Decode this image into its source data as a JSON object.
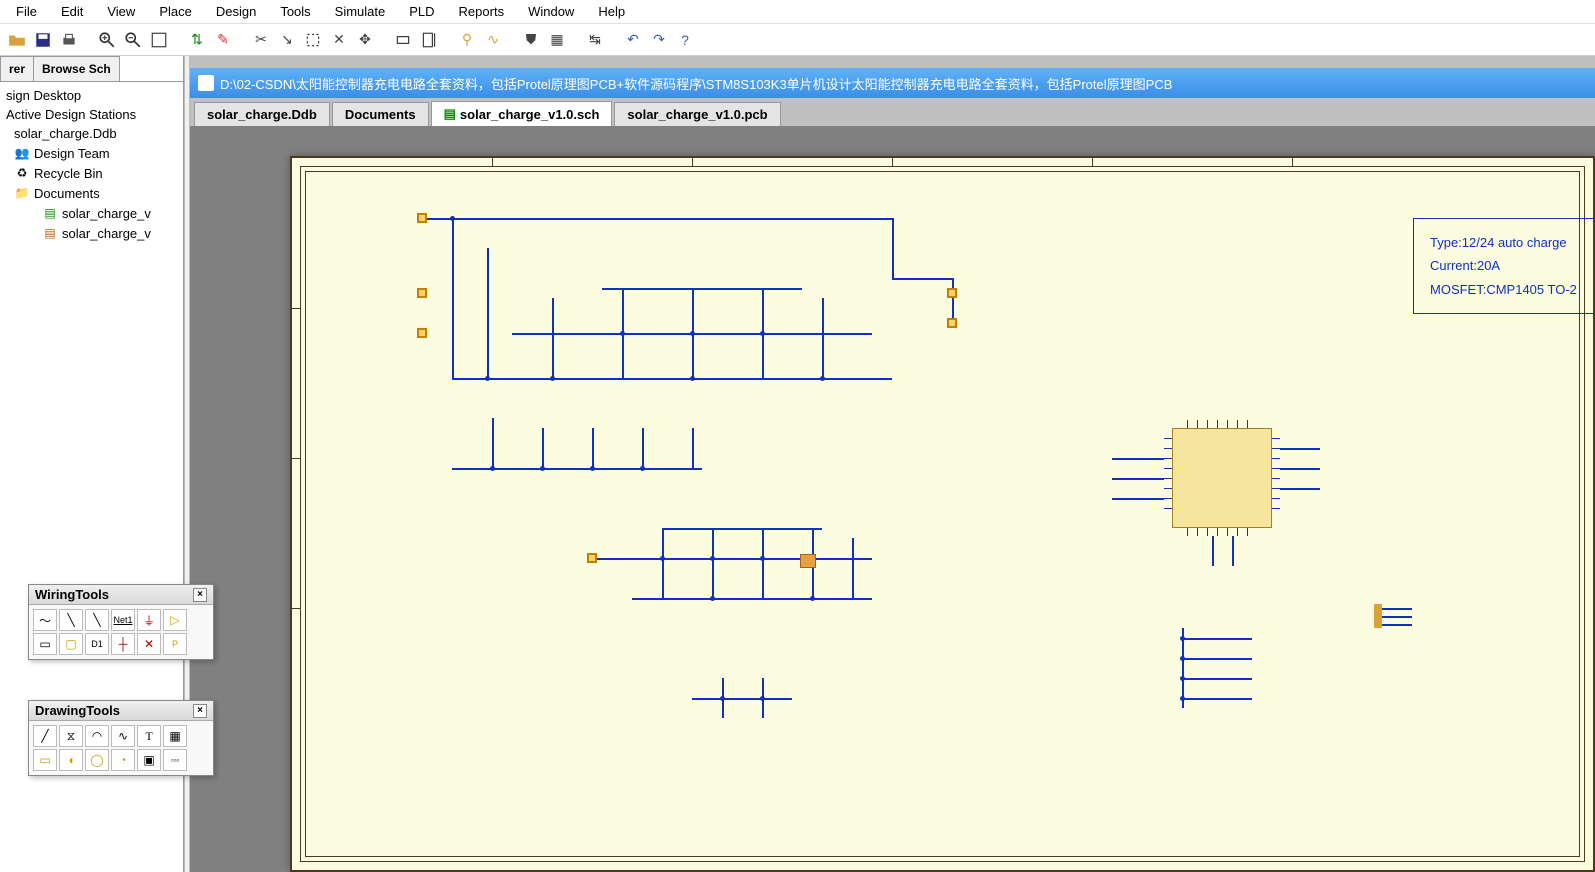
{
  "menu": {
    "items": [
      "File",
      "Edit",
      "View",
      "Place",
      "Design",
      "Tools",
      "Simulate",
      "PLD",
      "Reports",
      "Window",
      "Help"
    ]
  },
  "sidebar": {
    "tabs": [
      "rer",
      "Browse Sch"
    ],
    "tree": [
      {
        "label": "sign Desktop",
        "indent": 0,
        "icon": ""
      },
      {
        "label": "Active Design Stations",
        "indent": 0,
        "icon": ""
      },
      {
        "label": "solar_charge.Ddb",
        "indent": 1,
        "icon": "db"
      },
      {
        "label": "Design Team",
        "indent": 1,
        "icon": "team"
      },
      {
        "label": "Recycle Bin",
        "indent": 1,
        "icon": "bin"
      },
      {
        "label": "Documents",
        "indent": 1,
        "icon": "folder"
      },
      {
        "label": "solar_charge_v",
        "indent": 3,
        "icon": "sch"
      },
      {
        "label": "solar_charge_v",
        "indent": 3,
        "icon": "pcb"
      }
    ]
  },
  "title_path": "D:\\02-CSDN\\太阳能控制器充电电路全套资料，包括Protel原理图PCB+软件源码程序\\STM8S103K3单片机设计太阳能控制器充电电路全套资料，包括Protel原理图PCB",
  "doctabs": [
    {
      "label": "solar_charge.Ddb",
      "active": false
    },
    {
      "label": "Documents",
      "active": false
    },
    {
      "label": "solar_charge_v1.0.sch",
      "active": true,
      "icon": true
    },
    {
      "label": "solar_charge_v1.0.pcb",
      "active": false
    }
  ],
  "infobox": {
    "line1": "Type:12/24 auto charge",
    "line2": "Current:20A",
    "line3": "MOSFET:CMP1405 TO-2"
  },
  "wiring_toolbox": {
    "title": "WiringTools"
  },
  "drawing_toolbox": {
    "title": "DrawingTools"
  },
  "netlabel": "Net1"
}
